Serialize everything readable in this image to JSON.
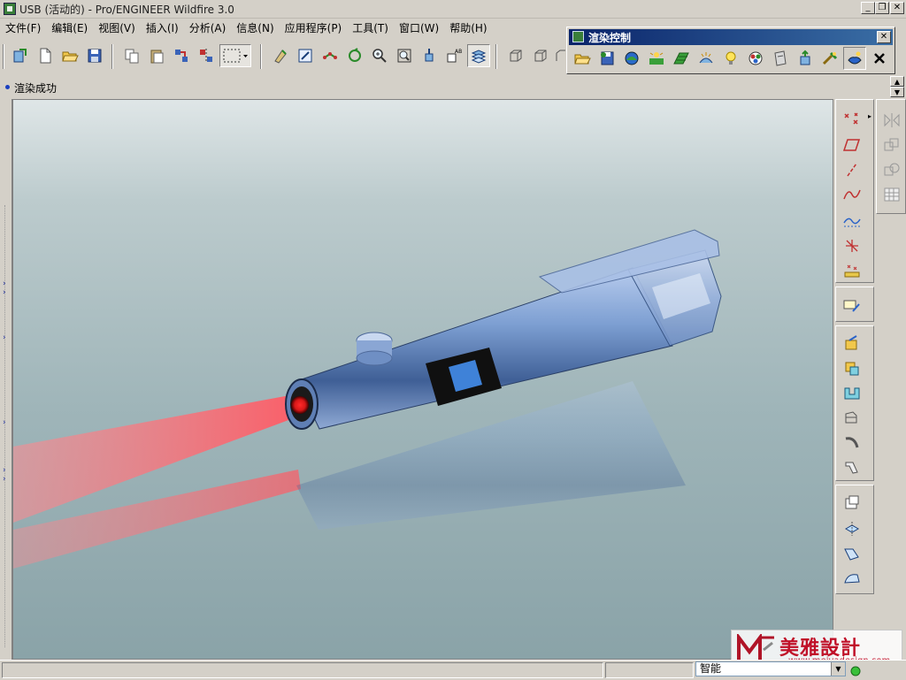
{
  "window": {
    "title": "USB (活动的) - Pro/ENGINEER Wildfire 3.0"
  },
  "menu": [
    {
      "label": "文件(F)"
    },
    {
      "label": "编辑(E)"
    },
    {
      "label": "视图(V)"
    },
    {
      "label": "插入(I)"
    },
    {
      "label": "分析(A)"
    },
    {
      "label": "信息(N)"
    },
    {
      "label": "应用程序(P)"
    },
    {
      "label": "工具(T)"
    },
    {
      "label": "窗口(W)"
    },
    {
      "label": "帮助(H)"
    }
  ],
  "render_dialog": {
    "title": "渲染控制"
  },
  "status": {
    "message": "渲染成功"
  },
  "bottom": {
    "filter": "智能"
  },
  "watermark": {
    "brand": "美雅設計",
    "url": "www.meiyadesign.com"
  },
  "colors": {
    "title_gradient_start": "#0a246a",
    "title_gradient_end": "#3a6ea5",
    "beam": "#ff5a64",
    "model_body": "#6d8fc0",
    "viewport_bg": "#9fb5b9"
  },
  "icons": {
    "toolbar": [
      "regenerate-icon",
      "new-file-icon",
      "open-folder-icon",
      "save-icon",
      "copy-icon",
      "paste-icon",
      "paste-special-icon",
      "mirror-icon",
      "select-box-icon",
      "repaint-icon",
      "view-manager-icon",
      "datum-axis-icon",
      "orient-icon",
      "zoom-in-icon",
      "zoom-fit-icon",
      "spin-center-icon",
      "named-view-icon",
      "layer-icon",
      "wireframe-icon",
      "hidden-line-icon",
      "no-hidden-icon"
    ],
    "render": [
      "open-folder-icon",
      "save-scene-icon",
      "room-icon",
      "lights-icon",
      "scene-icon",
      "effects-icon",
      "light-bulb-icon",
      "appearance-icon",
      "decal-icon",
      "render-setup-icon",
      "render-tool-icon",
      "render-window-icon",
      "close-icon"
    ],
    "right": [
      "datum-point-icon",
      "datum-plane-icon",
      "datum-axis-icon",
      "datum-curve-icon",
      "sketched-curve-icon",
      "coordinate-system-icon",
      "analysis-icon",
      "sketch-icon",
      "extrude-icon",
      "revolve-icon",
      "variable-sweep-icon",
      "blend-icon",
      "sweep-icon",
      "helical-sweep-icon",
      "hole-icon",
      "shell-icon",
      "rib-icon",
      "draft-icon"
    ],
    "right2": [
      "mirror-feature-icon",
      "pattern-icon",
      "copy-feature-icon",
      "table-icon"
    ]
  }
}
